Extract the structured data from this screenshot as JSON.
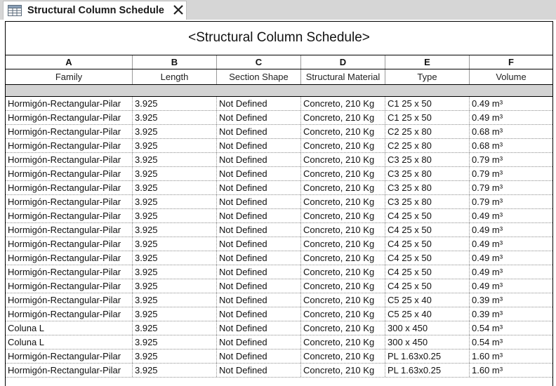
{
  "tab": {
    "title": "Structural Column Schedule"
  },
  "schedule": {
    "title": "<Structural Column Schedule>",
    "column_letters": [
      "A",
      "B",
      "C",
      "D",
      "E",
      "F"
    ],
    "headers": [
      "Family",
      "Length",
      "Section Shape",
      "Structural Material",
      "Type",
      "Volume"
    ],
    "rows": [
      [
        "Hormigón-Rectangular-Pilar",
        "3.925",
        "Not Defined",
        "Concreto, 210 Kg",
        "C1 25 x 50",
        "0.49 m³"
      ],
      [
        "Hormigón-Rectangular-Pilar",
        "3.925",
        "Not Defined",
        "Concreto, 210 Kg",
        "C1 25 x 50",
        "0.49 m³"
      ],
      [
        "Hormigón-Rectangular-Pilar",
        "3.925",
        "Not Defined",
        "Concreto, 210 Kg",
        "C2 25 x 80",
        "0.68 m³"
      ],
      [
        "Hormigón-Rectangular-Pilar",
        "3.925",
        "Not Defined",
        "Concreto, 210 Kg",
        "C2 25 x 80",
        "0.68 m³"
      ],
      [
        "Hormigón-Rectangular-Pilar",
        "3.925",
        "Not Defined",
        "Concreto, 210 Kg",
        "C3 25 x 80",
        "0.79 m³"
      ],
      [
        "Hormigón-Rectangular-Pilar",
        "3.925",
        "Not Defined",
        "Concreto, 210 Kg",
        "C3 25 x 80",
        "0.79 m³"
      ],
      [
        "Hormigón-Rectangular-Pilar",
        "3.925",
        "Not Defined",
        "Concreto, 210 Kg",
        "C3 25 x 80",
        "0.79 m³"
      ],
      [
        "Hormigón-Rectangular-Pilar",
        "3.925",
        "Not Defined",
        "Concreto, 210 Kg",
        "C3 25 x 80",
        "0.79 m³"
      ],
      [
        "Hormigón-Rectangular-Pilar",
        "3.925",
        "Not Defined",
        "Concreto, 210 Kg",
        "C4 25 x 50",
        "0.49 m³"
      ],
      [
        "Hormigón-Rectangular-Pilar",
        "3.925",
        "Not Defined",
        "Concreto, 210 Kg",
        "C4 25 x 50",
        "0.49 m³"
      ],
      [
        "Hormigón-Rectangular-Pilar",
        "3.925",
        "Not Defined",
        "Concreto, 210 Kg",
        "C4 25 x 50",
        "0.49 m³"
      ],
      [
        "Hormigón-Rectangular-Pilar",
        "3.925",
        "Not Defined",
        "Concreto, 210 Kg",
        "C4 25 x 50",
        "0.49 m³"
      ],
      [
        "Hormigón-Rectangular-Pilar",
        "3.925",
        "Not Defined",
        "Concreto, 210 Kg",
        "C4 25 x 50",
        "0.49 m³"
      ],
      [
        "Hormigón-Rectangular-Pilar",
        "3.925",
        "Not Defined",
        "Concreto, 210 Kg",
        "C4 25 x 50",
        "0.49 m³"
      ],
      [
        "Hormigón-Rectangular-Pilar",
        "3.925",
        "Not Defined",
        "Concreto, 210 Kg",
        "C5 25 x 40",
        "0.39 m³"
      ],
      [
        "Hormigón-Rectangular-Pilar",
        "3.925",
        "Not Defined",
        "Concreto, 210 Kg",
        "C5 25 x 40",
        "0.39 m³"
      ],
      [
        "Coluna L",
        "3.925",
        "Not Defined",
        "Concreto, 210 Kg",
        "300 x 450",
        "0.54 m³"
      ],
      [
        "Coluna L",
        "3.925",
        "Not Defined",
        "Concreto, 210 Kg",
        "300 x 450",
        "0.54 m³"
      ],
      [
        "Hormigón-Rectangular-Pilar",
        "3.925",
        "Not Defined",
        "Concreto, 210 Kg",
        "PL 1.63x0.25",
        "1.60 m³"
      ],
      [
        "Hormigón-Rectangular-Pilar",
        "3.925",
        "Not Defined",
        "Concreto, 210 Kg",
        "PL 1.63x0.25",
        "1.60 m³"
      ]
    ]
  },
  "icons": {
    "tab": "schedule-table-icon",
    "close": "close-icon"
  }
}
